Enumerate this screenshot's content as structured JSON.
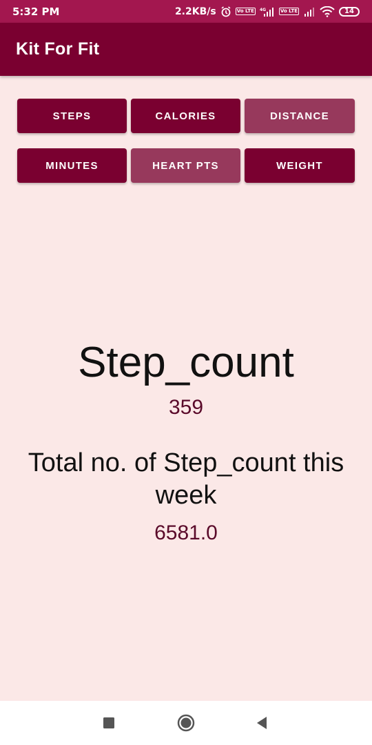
{
  "status_bar": {
    "time": "5:32 PM",
    "net_speed": "2.2KB/s",
    "network_type": "4G",
    "volte_label": "Vo LTE",
    "battery": "14"
  },
  "app_bar": {
    "title": "Kit For Fit"
  },
  "tabs": [
    {
      "label": "STEPS",
      "variant": "dark"
    },
    {
      "label": "CALORIES",
      "variant": "dark"
    },
    {
      "label": "DISTANCE",
      "variant": "light"
    },
    {
      "label": "MINUTES",
      "variant": "dark"
    },
    {
      "label": "HEART PTS",
      "variant": "light"
    },
    {
      "label": "WEIGHT",
      "variant": "dark"
    }
  ],
  "metric": {
    "title": "Step_count",
    "value": "359",
    "weekly_label": "Total no. of Step_count this week",
    "weekly_value": "6581.0"
  },
  "nav": {
    "icons": [
      "recents-icon",
      "home-icon",
      "back-icon"
    ]
  },
  "colors": {
    "status_bar": "#a3174f",
    "app_bar": "#7a0030",
    "button_dark": "#7a0030",
    "button_light": "#97395c",
    "background": "#fbe8e7",
    "value_text": "#5a0a2a"
  }
}
